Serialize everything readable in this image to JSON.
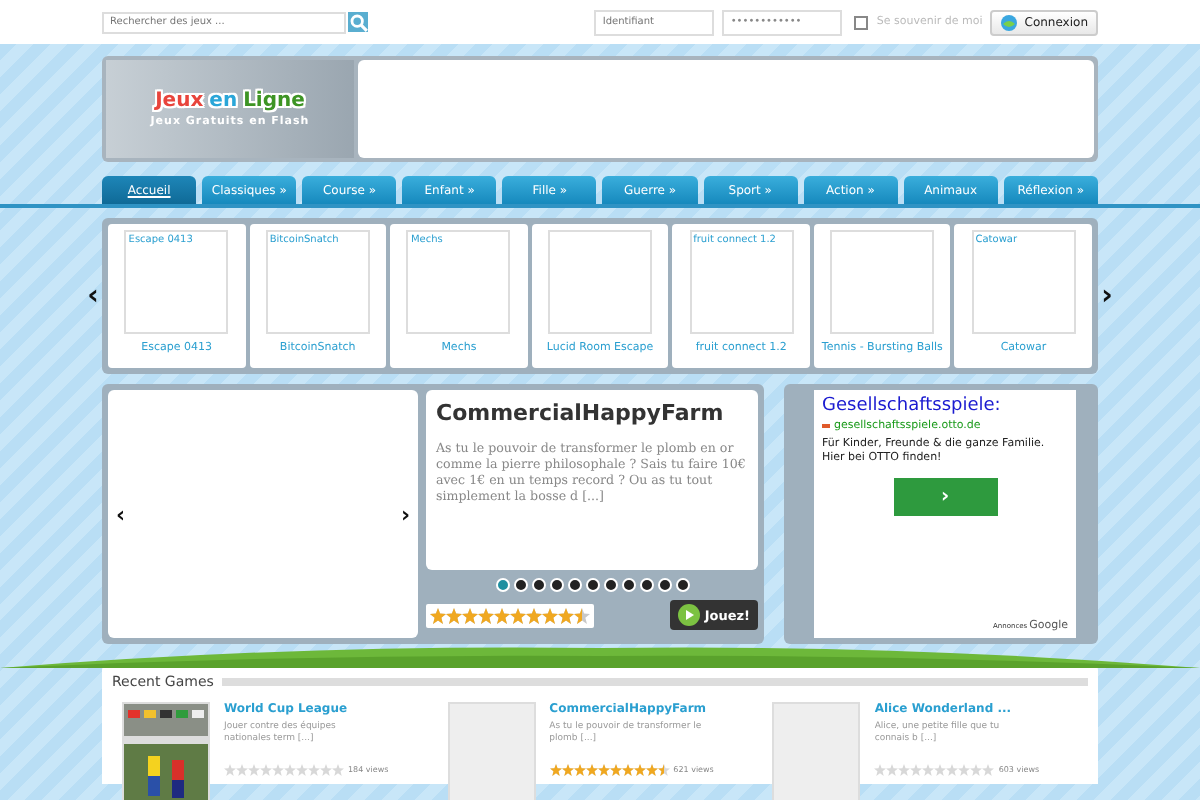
{
  "top_bar": {
    "search": {
      "placeholder": "Rechercher des jeux ..."
    },
    "login": {
      "username": {
        "placeholder": "Identifiant"
      },
      "password": {
        "value": "••••••••••••"
      },
      "remember": {
        "label": "Se souvenir de moi",
        "checked": false
      },
      "button": "Connexion"
    }
  },
  "logo": {
    "words": [
      {
        "text": "Jeux",
        "color": "#e8443c"
      },
      {
        "text": "en",
        "color": "#2aa6d8"
      },
      {
        "text": "Ligne",
        "color": "#3d9424"
      }
    ],
    "tagline": "Jeux Gratuits en Flash"
  },
  "nav": [
    {
      "label": "Accueil",
      "selected": true
    },
    {
      "label": "Classiques »",
      "selected": false
    },
    {
      "label": "Course »",
      "selected": false
    },
    {
      "label": "Enfant »",
      "selected": false
    },
    {
      "label": "Fille »",
      "selected": false
    },
    {
      "label": "Guerre »",
      "selected": false
    },
    {
      "label": "Sport »",
      "selected": false
    },
    {
      "label": "Action »",
      "selected": false
    },
    {
      "label": "Animaux",
      "selected": false
    },
    {
      "label": "Réflexion »",
      "selected": false
    }
  ],
  "carousel": {
    "prev": "‹",
    "next": "›",
    "games": [
      {
        "thumb_text": "Escape 0413",
        "title": "Escape 0413"
      },
      {
        "thumb_text": "BitcoinSnatch",
        "title": "BitcoinSnatch"
      },
      {
        "thumb_text": "Mechs",
        "title": "Mechs"
      },
      {
        "title": "Lucid Room Escape"
      },
      {
        "thumb_text": "fruit connect 1.2",
        "title": "fruit connect 1.2"
      },
      {
        "title": "Tennis - Bursting Balls"
      },
      {
        "thumb_text": "Catowar",
        "title": "Catowar"
      }
    ]
  },
  "featured": {
    "prev": "‹",
    "next": "›",
    "title": "CommercialHappyFarm",
    "description": "As tu le pouvoir de transformer le plomb en or comme la pierre philosophale ? Sais tu faire 10€ avec 1€ en un temps record ? Ou as tu tout simplement la bosse d [...]",
    "stars": 9.5,
    "play_button": "Jouez!",
    "pager": [
      {
        "selected": true
      },
      {
        "selected": false
      },
      {
        "selected": false
      },
      {
        "selected": false
      },
      {
        "selected": false
      },
      {
        "selected": false
      },
      {
        "selected": false
      },
      {
        "selected": false
      },
      {
        "selected": false
      },
      {
        "selected": false
      },
      {
        "selected": false
      }
    ]
  },
  "ad": {
    "headline": "Gesellschaftsspiele:",
    "url": "gesellschaftsspiele.otto.de",
    "text": "Für Kinder, Freunde & die ganze Familie. Hier bei OTTO finden!",
    "button": "›",
    "footer_label": "Annonces",
    "footer_brand": "Google"
  },
  "recent": {
    "title": "Recent Games",
    "games": [
      {
        "title": "World Cup League",
        "description": "Jouer contre des équipes nationales term [...]",
        "stars": 0,
        "views": "184 views",
        "kind": "picture"
      },
      {
        "title": "CommercialHappyFarm",
        "description": "As tu le pouvoir de transformer le plomb [...]",
        "stars": 9.5,
        "views": "621 views"
      },
      {
        "title": "Alice Wonderland ...",
        "description": "Alice, une petite fille que tu connais b [...]",
        "stars": 0,
        "views": "603 views"
      }
    ]
  }
}
